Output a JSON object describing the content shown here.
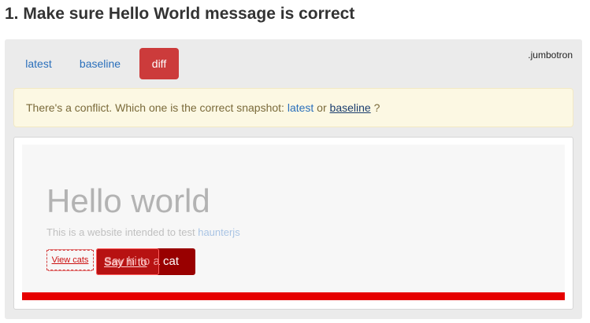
{
  "page": {
    "title": "1. Make sure Hello World message is correct"
  },
  "panel": {
    "selector": ".jumbotron",
    "tabs": [
      {
        "label": "latest",
        "active": false
      },
      {
        "label": "baseline",
        "active": false
      },
      {
        "label": "diff",
        "active": true
      }
    ]
  },
  "alert": {
    "text_before": "There's a conflict. Which one is the correct snapshot: ",
    "latest_link": "latest",
    "text_or": " or ",
    "baseline_link": "baseline",
    "text_after": " ?"
  },
  "snapshot": {
    "heading": "Hello world",
    "lead_text": "This is a website intended to test ",
    "lead_link": "haunterjs",
    "view_cats_button": "View cats",
    "say_hi_button": "Say hi to a cat",
    "say_hi_overlay": "Say hi to"
  },
  "colors": {
    "diff_tab": "#cc3b3b",
    "diff_bar": "#e60000",
    "alert_bg": "#fcf8e3",
    "link": "#2a6fbb"
  }
}
